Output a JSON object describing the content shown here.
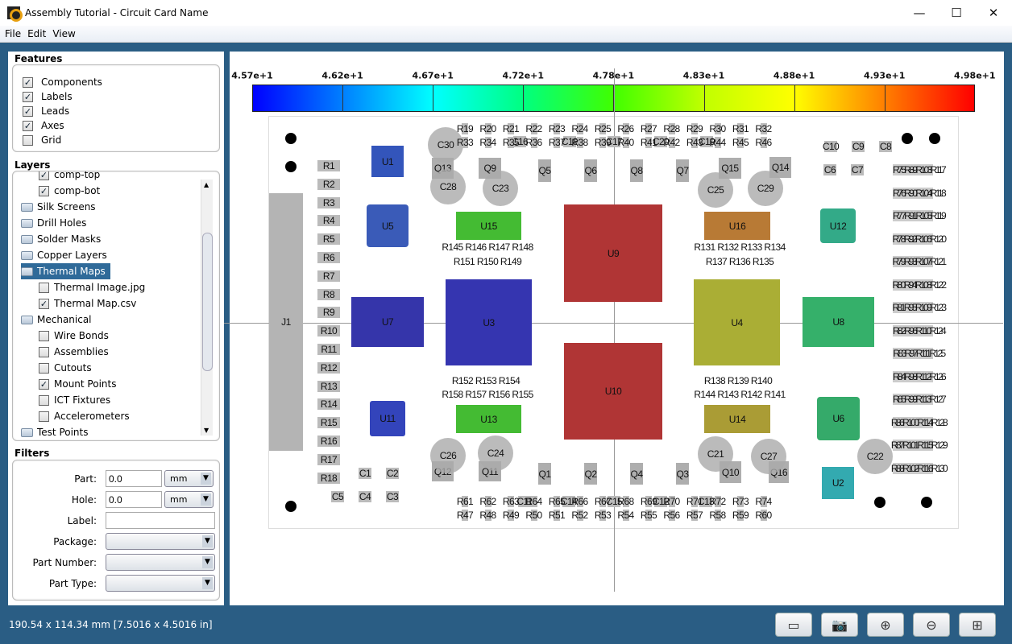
{
  "window": {
    "title": "Assembly Tutorial - Circuit Card Name",
    "minimize": "—",
    "maximize": "☐",
    "close": "✕"
  },
  "menu": [
    "File",
    "Edit",
    "View"
  ],
  "features": {
    "title": "Features",
    "items": [
      {
        "label": "Components",
        "checked": true
      },
      {
        "label": "Labels",
        "checked": true
      },
      {
        "label": "Leads",
        "checked": true
      },
      {
        "label": "Axes",
        "checked": true
      },
      {
        "label": "Grid",
        "checked": false
      }
    ]
  },
  "layers": {
    "title": "Layers",
    "items": [
      {
        "label": "comp-top",
        "type": "check",
        "checked": true,
        "level": 2
      },
      {
        "label": "comp-bot",
        "type": "check",
        "checked": true,
        "level": 2
      },
      {
        "label": "Silk Screens",
        "type": "folder",
        "level": 1
      },
      {
        "label": "Drill Holes",
        "type": "folder",
        "level": 1
      },
      {
        "label": "Solder Masks",
        "type": "folder",
        "level": 1
      },
      {
        "label": "Copper Layers",
        "type": "folder",
        "level": 1
      },
      {
        "label": "Thermal Maps",
        "type": "folder",
        "level": 1,
        "selected": true
      },
      {
        "label": "Thermal Image.jpg",
        "type": "check",
        "checked": false,
        "level": 2
      },
      {
        "label": "Thermal Map.csv",
        "type": "check",
        "checked": true,
        "level": 2
      },
      {
        "label": "Mechanical",
        "type": "folder",
        "level": 1
      },
      {
        "label": "Wire Bonds",
        "type": "check",
        "checked": false,
        "level": 2
      },
      {
        "label": "Assemblies",
        "type": "check",
        "checked": false,
        "level": 2
      },
      {
        "label": "Cutouts",
        "type": "check",
        "checked": false,
        "level": 2
      },
      {
        "label": "Mount Points",
        "type": "check",
        "checked": true,
        "level": 2
      },
      {
        "label": "ICT Fixtures",
        "type": "check",
        "checked": false,
        "level": 2
      },
      {
        "label": "Accelerometers",
        "type": "check",
        "checked": false,
        "level": 2
      },
      {
        "label": "Test Points",
        "type": "folder",
        "level": 1
      }
    ]
  },
  "filters": {
    "title": "Filters",
    "part_label": "Part:",
    "part_value": "0.0",
    "part_unit": "mm",
    "hole_label": "Hole:",
    "hole_value": "0.0",
    "hole_unit": "mm",
    "label_label": "Label:",
    "label_value": "",
    "package_label": "Package:",
    "package_value": "",
    "part_number_label": "Part Number:",
    "part_number_value": "",
    "part_type_label": "Part Type:",
    "part_type_value": ""
  },
  "colorbar": {
    "ticks": [
      "4.57e+1",
      "4.62e+1",
      "4.67e+1",
      "4.72e+1",
      "4.78e+1",
      "4.83e+1",
      "4.88e+1",
      "4.93e+1",
      "4.98e+1"
    ],
    "colors": [
      "#0000ff",
      "#0080ff",
      "#00ffff",
      "#00ff80",
      "#40ff00",
      "#c0ff00",
      "#ffff00",
      "#ff8000",
      "#ff0000"
    ]
  },
  "board": {
    "ics": [
      {
        "label": "U1",
        "color": "#3355bb"
      },
      {
        "label": "U5",
        "color": "#3a5bb8"
      },
      {
        "label": "U15",
        "color": "#44bb33"
      },
      {
        "label": "U16",
        "color": "#b87a35"
      },
      {
        "label": "U12",
        "color": "#33aa88"
      },
      {
        "label": "U9",
        "color": "#b03535"
      },
      {
        "label": "U10",
        "color": "#b03535"
      },
      {
        "label": "U7",
        "color": "#3535aa"
      },
      {
        "label": "U3",
        "color": "#3535b0"
      },
      {
        "label": "U4",
        "color": "#aaae35"
      },
      {
        "label": "U8",
        "color": "#35b06a"
      },
      {
        "label": "U11",
        "color": "#3344bb"
      },
      {
        "label": "U13",
        "color": "#44bb33"
      },
      {
        "label": "U14",
        "color": "#aa9c35"
      },
      {
        "label": "U6",
        "color": "#35aa6a"
      },
      {
        "label": "U2",
        "color": "#33aab0"
      },
      {
        "label": "J1",
        "color": "#b4b4b4"
      }
    ],
    "capacitors_round": [
      "C30",
      "C28",
      "C23",
      "C25",
      "C29",
      "C26",
      "C24",
      "C21",
      "C27",
      "C22"
    ],
    "transistors": [
      "Q13",
      "Q9",
      "Q5",
      "Q6",
      "Q8",
      "Q7",
      "Q15",
      "Q14",
      "Q12",
      "Q11",
      "Q1",
      "Q2",
      "Q4",
      "Q3",
      "Q10",
      "Q16"
    ],
    "small_caps": [
      "C10",
      "C9",
      "C8",
      "C6",
      "C7",
      "C1",
      "C2",
      "C5",
      "C4",
      "C3",
      "C16",
      "C18",
      "C17",
      "C20",
      "C19",
      "C11",
      "C14",
      "C15",
      "C12",
      "C13"
    ],
    "resistors_left": [
      "R1",
      "R2",
      "R3",
      "R4",
      "R5",
      "R6",
      "R7",
      "R8",
      "R9",
      "R10",
      "R11",
      "R12",
      "R13",
      "R14",
      "R15",
      "R16",
      "R17",
      "R18"
    ],
    "resistors_top1": [
      "R19",
      "R20",
      "R21",
      "R22",
      "R23",
      "R24",
      "R25",
      "R26",
      "R27",
      "R28",
      "R29",
      "R30",
      "R31",
      "R32"
    ],
    "resistors_top2": [
      "R33",
      "R34",
      "R35",
      "R36",
      "R37",
      "R38",
      "R39",
      "R40",
      "R41",
      "R42",
      "R43",
      "R44",
      "R45",
      "R46"
    ],
    "resistors_bot1": [
      "R61",
      "R62",
      "R63",
      "R64",
      "R65",
      "R66",
      "R67",
      "R68",
      "R69",
      "R70",
      "R71",
      "R72",
      "R73",
      "R74"
    ],
    "resistors_bot2": [
      "R47",
      "R48",
      "R49",
      "R50",
      "R51",
      "R52",
      "R53",
      "R54",
      "R55",
      "R56",
      "R57",
      "R58",
      "R59",
      "R60"
    ],
    "resistors_right": [
      "R75R89R103R117",
      "R76R90R104R118",
      "R77R91R105R119",
      "R78R92R106R120",
      "R79R93R107R121",
      "R80R94R108R122",
      "R81R95R109R123",
      "R82R96R110R124",
      "R83R97R111R125",
      "R84R98R112R126",
      "R85R99R113R127",
      "R86R100R114R128",
      "R87R101R115R129",
      "R88R102R116R130"
    ],
    "resistor_groups": [
      "R145 R146 R147 R148",
      "R151 R150 R149",
      "R131 R132 R133 R134",
      "R137 R136 R135",
      "R152 R153 R154",
      "R158 R157 R156 R155",
      "R138 R139 R140",
      "R144 R143 R142 R141"
    ],
    "mount_hole_count": 7
  },
  "status": {
    "dimensions": "190.54 x 114.34 mm  [7.5016 x 4.5016 in]"
  },
  "toolbar": [
    {
      "icon": "ruler-icon",
      "glyph": "▭"
    },
    {
      "icon": "camera-icon",
      "glyph": "📷"
    },
    {
      "icon": "zoom-in-icon",
      "glyph": "⊕"
    },
    {
      "icon": "zoom-out-icon",
      "glyph": "⊖"
    },
    {
      "icon": "zoom-fit-icon",
      "glyph": "⊞"
    }
  ]
}
